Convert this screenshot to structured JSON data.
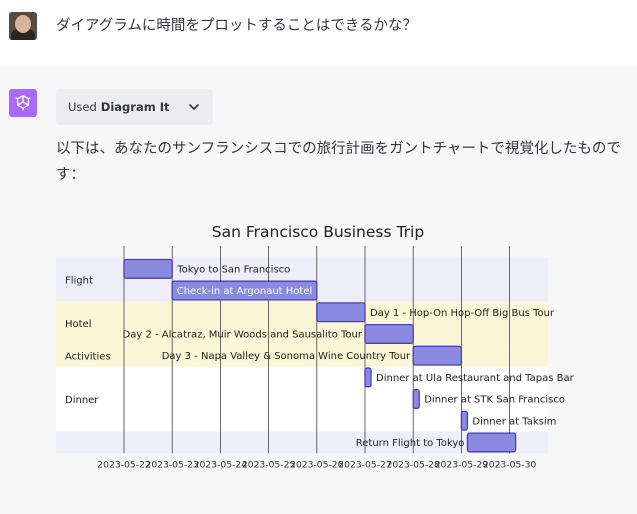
{
  "user_message": "ダイアグラムに時間をプロットすることはできるかな？",
  "plugin": {
    "prefix": "Used",
    "name": "Diagram It"
  },
  "assistant_message": "以下は、あなたのサンフランシスコでの旅行計画をガントチャートで視覚化したものです：",
  "colors": {
    "accent": "#ab68ff",
    "bar_fill": "#8a8ae0",
    "bar_stroke": "#4a3fb5",
    "band_lavender": "#eeeefa",
    "band_yellow": "#fbf7d6"
  },
  "chart_data": {
    "type": "gantt",
    "title": "San Francisco Business Trip",
    "x_ticks": [
      "2023-05-22",
      "2023-05-23",
      "2023-05-24",
      "2023-05-25",
      "2023-05-26",
      "2023-05-27",
      "2023-05-28",
      "2023-05-29",
      "2023-05-30"
    ],
    "xlim": [
      "2023-05-21 12:00",
      "2023-05-31 00:00"
    ],
    "sections": [
      {
        "name": "Flight",
        "band": "lavender",
        "rows": [
          0,
          1
        ]
      },
      {
        "name": "Hotel",
        "band": "yellow",
        "rows": [
          2,
          3
        ]
      },
      {
        "name": "Activities",
        "band": "yellow",
        "rows": [
          4
        ]
      },
      {
        "name": "Dinner",
        "band": "white",
        "rows": [
          5,
          6,
          7
        ]
      },
      {
        "name": "",
        "band": "lavender",
        "rows": [
          8
        ]
      }
    ],
    "tasks": [
      {
        "label": "Tokyo to San Francisco",
        "start": "2023-05-22 00:00",
        "end": "2023-05-23 00:00",
        "label_pos": "right"
      },
      {
        "label": "Check-in at Argonaut Hotel",
        "start": "2023-05-23 00:00",
        "end": "2023-05-26 00:00",
        "label_pos": "inside"
      },
      {
        "label": "Day 1 - Hop-On Hop-Off Big Bus Tour",
        "start": "2023-05-26 00:00",
        "end": "2023-05-27 00:00",
        "label_pos": "right"
      },
      {
        "label": "Day 2 - Alcatraz, Muir Woods and Sausalito Tour",
        "start": "2023-05-27 00:00",
        "end": "2023-05-28 00:00",
        "label_pos": "left"
      },
      {
        "label": "Day 3 - Napa Valley & Sonoma Wine Country Tour",
        "start": "2023-05-28 00:00",
        "end": "2023-05-29 00:00",
        "label_pos": "left"
      },
      {
        "label": "Dinner at Ula Restaurant and Tapas Bar",
        "start": "2023-05-27 00:00",
        "end": "2023-05-27 03:00",
        "label_pos": "right"
      },
      {
        "label": "Dinner at STK San Francisco",
        "start": "2023-05-28 00:00",
        "end": "2023-05-28 03:00",
        "label_pos": "right"
      },
      {
        "label": "Dinner at Taksim",
        "start": "2023-05-29 00:00",
        "end": "2023-05-29 03:00",
        "label_pos": "right"
      },
      {
        "label": "Return Flight to Tokyo",
        "start": "2023-05-29 03:00",
        "end": "2023-05-30 03:00",
        "label_pos": "left"
      }
    ]
  }
}
